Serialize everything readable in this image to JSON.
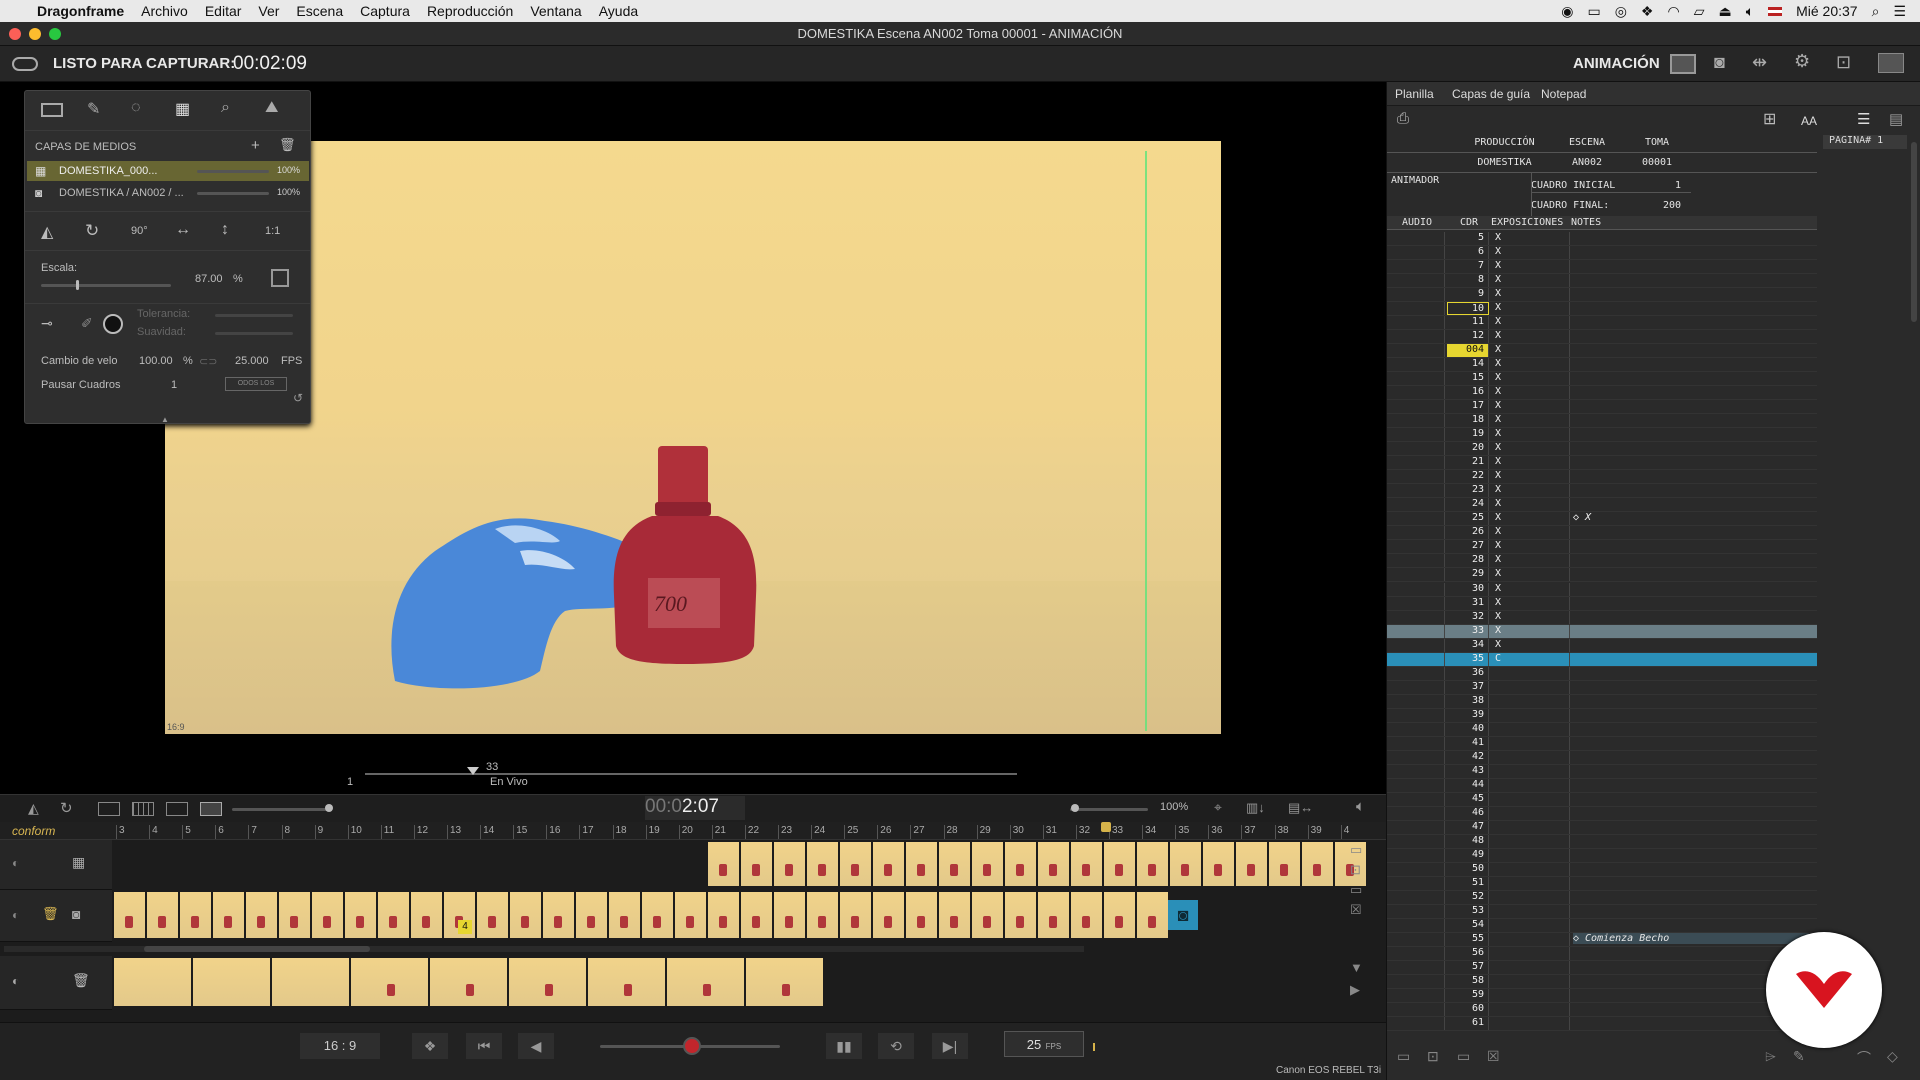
{
  "menubar": {
    "app": "Dragonframe",
    "items": [
      "Archivo",
      "Editar",
      "Ver",
      "Escena",
      "Captura",
      "Reproducción",
      "Ventana",
      "Ayuda"
    ],
    "clock": "Mié 20:37"
  },
  "window": {
    "title": "DOMESTIKA  Escena AN002  Toma 00001 - ANIMACIÓN"
  },
  "topbar": {
    "status": "LISTO PARA CAPTURAR:",
    "time": "00:02:09",
    "mode": "ANIMACIÓN"
  },
  "panel": {
    "title": "CAPAS DE MEDIOS",
    "layers": [
      {
        "name": "DOMESTIKA_000...",
        "opacity": "100%"
      },
      {
        "name": "DOMESTIKA / AN002 / ...",
        "opacity": "100%"
      }
    ],
    "rotate_label": "90°",
    "ratio_label": "1:1",
    "scale_label": "Escala:",
    "scale_value": "87.00",
    "scale_unit": "%",
    "tolerance_label": "Tolerancia:",
    "smooth_label": "Suavidad:",
    "speed_label": "Cambio de velo",
    "speed_value": "100.00",
    "speed_unit": "%",
    "fps_value": "25.000",
    "fps_unit": "FPS",
    "pause_label": "Pausar Cuadros",
    "pause_value": "1",
    "pause_button": "ODOS LOS CUADR"
  },
  "viewer": {
    "aspect_badge": "16:9",
    "scrub_start": "1",
    "scrub_pos": "33",
    "scrub_label": "En Vivo"
  },
  "tlbar": {
    "timecode_dim": "00:0",
    "timecode_bright": "2:07",
    "zoom": "100%"
  },
  "timeline": {
    "scene_label": "conform",
    "ticks": [
      "3",
      "4",
      "5",
      "6",
      "7",
      "8",
      "9",
      "10",
      "11",
      "12",
      "13",
      "14",
      "15",
      "16",
      "17",
      "18",
      "19",
      "20",
      "21",
      "22",
      "23",
      "24",
      "25",
      "26",
      "27",
      "28",
      "29",
      "30",
      "31",
      "32",
      "33",
      "34",
      "35",
      "36",
      "37",
      "38",
      "39",
      "4"
    ],
    "marker": "4"
  },
  "bottom": {
    "ratio": "16 : 9",
    "fps_value": "25",
    "fps_unit": "FPS",
    "camera": "Canon EOS REBEL T3i"
  },
  "sheet": {
    "tabs": [
      "Planilla",
      "Capas de guía",
      "Notepad"
    ],
    "aa": "AA",
    "page": "PAGINA# 1",
    "hdr": {
      "production_label": "PRODUCCIÓN",
      "scene_label": "ESCENA",
      "take_label": "TOMA",
      "production": "DOMESTIKA",
      "scene": "AN002",
      "take": "00001",
      "animator_label": "ANIMADOR",
      "start_label": "CUADRO INICIAL",
      "start": "1",
      "end_label": "CUADRO FINAL:",
      "end": "200"
    },
    "cols": [
      "AUDIO",
      "CDR",
      "EXPOSICIONES",
      "NOTES"
    ],
    "rows": [
      {
        "n": "5",
        "e": "X"
      },
      {
        "n": "6",
        "e": "X"
      },
      {
        "n": "7",
        "e": "X"
      },
      {
        "n": "8",
        "e": "X"
      },
      {
        "n": "9",
        "e": "X"
      },
      {
        "n": "10",
        "e": "X"
      },
      {
        "n": "11",
        "e": "X"
      },
      {
        "n": "12",
        "e": "X"
      },
      {
        "n": "004",
        "e": "X"
      },
      {
        "n": "14",
        "e": "X"
      },
      {
        "n": "15",
        "e": "X"
      },
      {
        "n": "16",
        "e": "X"
      },
      {
        "n": "17",
        "e": "X"
      },
      {
        "n": "18",
        "e": "X"
      },
      {
        "n": "19",
        "e": "X"
      },
      {
        "n": "20",
        "e": "X"
      },
      {
        "n": "21",
        "e": "X"
      },
      {
        "n": "22",
        "e": "X"
      },
      {
        "n": "23",
        "e": "X"
      },
      {
        "n": "24",
        "e": "X"
      },
      {
        "n": "25",
        "e": "X",
        "note": "◇ X"
      },
      {
        "n": "26",
        "e": "X"
      },
      {
        "n": "27",
        "e": "X"
      },
      {
        "n": "28",
        "e": "X"
      },
      {
        "n": "29",
        "e": "X"
      },
      {
        "n": "30",
        "e": "X"
      },
      {
        "n": "31",
        "e": "X"
      },
      {
        "n": "32",
        "e": "X"
      },
      {
        "n": "33",
        "e": "X"
      },
      {
        "n": "34",
        "e": "X"
      },
      {
        "n": "35",
        "e": "C"
      },
      {
        "n": "36"
      },
      {
        "n": "37"
      },
      {
        "n": "38"
      },
      {
        "n": "39"
      },
      {
        "n": "40"
      },
      {
        "n": "41"
      },
      {
        "n": "42"
      },
      {
        "n": "43"
      },
      {
        "n": "44"
      },
      {
        "n": "45"
      },
      {
        "n": "46"
      },
      {
        "n": "47"
      },
      {
        "n": "48"
      },
      {
        "n": "49"
      },
      {
        "n": "50"
      },
      {
        "n": "51"
      },
      {
        "n": "52"
      },
      {
        "n": "53"
      },
      {
        "n": "54"
      },
      {
        "n": "55",
        "note": "◇ Comienza Becho"
      },
      {
        "n": "56"
      },
      {
        "n": "57"
      },
      {
        "n": "58"
      },
      {
        "n": "59"
      },
      {
        "n": "60"
      },
      {
        "n": "61"
      }
    ]
  },
  "colors": {
    "accent_blue": "#2a8fb8",
    "highlight_row": "#6a7e86",
    "yellow": "#e6d630",
    "logo_red": "#d8141f"
  }
}
